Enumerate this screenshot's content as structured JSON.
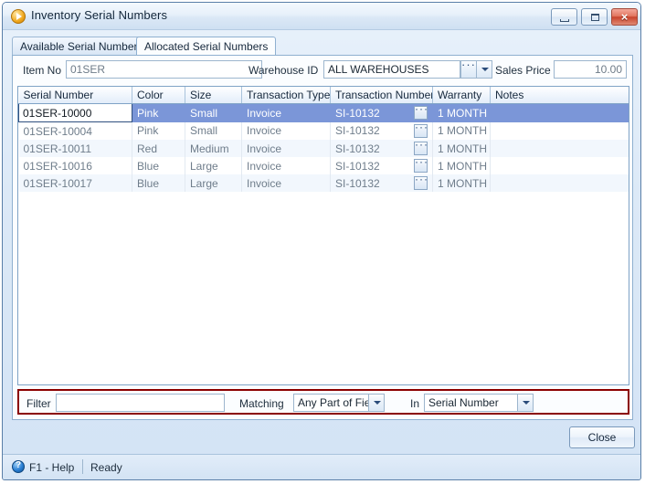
{
  "window": {
    "title": "Inventory Serial Numbers",
    "icon": "play-circle-icon",
    "minimize_label": "Minimize",
    "maximize_label": "Maximize",
    "close_label": "×"
  },
  "tabs": [
    {
      "label": "Available Serial Numbers",
      "active": false
    },
    {
      "label": "Allocated Serial Numbers",
      "active": true
    }
  ],
  "fields": {
    "item_no_label": "Item No",
    "item_no_value": "01SER",
    "warehouse_label": "Warehouse ID",
    "warehouse_value": "ALL WAREHOUSES",
    "sales_price_label": "Sales Price",
    "sales_price_value": "10.00"
  },
  "grid": {
    "columns": [
      "Serial Number",
      "Color",
      "Size",
      "Transaction Type",
      "Transaction Number",
      "Warranty",
      "Notes"
    ],
    "rows": [
      {
        "serial_number": "01SER-10000",
        "color": "Pink",
        "size": "Small",
        "transaction_type": "Invoice",
        "transaction_number": "SI-10132",
        "warranty": "1 MONTH",
        "notes": "",
        "selected": true
      },
      {
        "serial_number": "01SER-10004",
        "color": "Pink",
        "size": "Small",
        "transaction_type": "Invoice",
        "transaction_number": "SI-10132",
        "warranty": "1 MONTH",
        "notes": "",
        "selected": false
      },
      {
        "serial_number": "01SER-10011",
        "color": "Red",
        "size": "Medium",
        "transaction_type": "Invoice",
        "transaction_number": "SI-10132",
        "warranty": "1 MONTH",
        "notes": "",
        "selected": false
      },
      {
        "serial_number": "01SER-10016",
        "color": "Blue",
        "size": "Large",
        "transaction_type": "Invoice",
        "transaction_number": "SI-10132",
        "warranty": "1 MONTH",
        "notes": "",
        "selected": false
      },
      {
        "serial_number": "01SER-10017",
        "color": "Blue",
        "size": "Large",
        "transaction_type": "Invoice",
        "transaction_number": "SI-10132",
        "warranty": "1 MONTH",
        "notes": "",
        "selected": false
      }
    ]
  },
  "filter": {
    "filter_label": "Filter",
    "filter_value": "",
    "matching_label": "Matching",
    "matching_value": "Any Part of Field",
    "in_label": "In",
    "in_value": "Serial Number",
    "highlight_color": "#8b0000"
  },
  "footer": {
    "close_button": "Close"
  },
  "status": {
    "help": "F1 - Help",
    "ready": "Ready"
  }
}
